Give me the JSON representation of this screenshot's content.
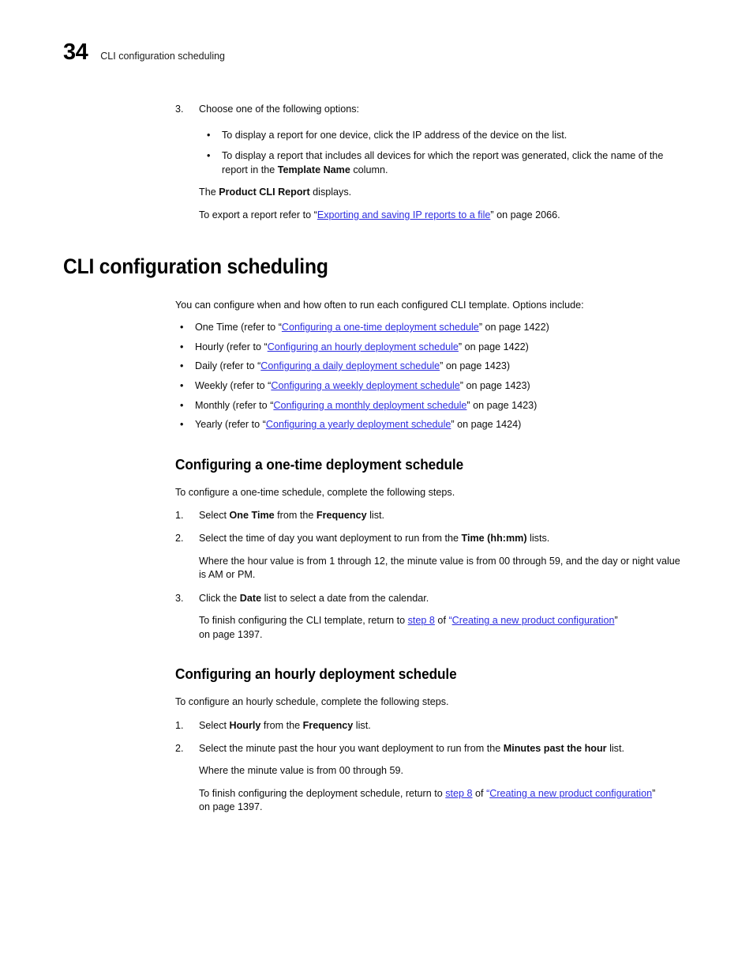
{
  "header": {
    "folio": "34",
    "running_title": "CLI configuration scheduling"
  },
  "step3": {
    "num": "3.",
    "text": "Choose one of the following options:",
    "bullets": [
      {
        "dot": "•",
        "text": "To display a report for one device, click the IP address of the device on the list."
      },
      {
        "dot": "•",
        "pre": "To display a report that includes all devices for which the report was generated, click the name of the report in the ",
        "bold": "Template Name",
        "post": " column."
      }
    ],
    "product_report": {
      "pre": "The ",
      "bold": "Product CLI Report",
      "post": " displays."
    },
    "export": {
      "pre": "To export a report refer to ",
      "openq": "“",
      "link": "Exporting and saving IP reports to a file",
      "closeq": "”",
      "post": " on page 2066."
    }
  },
  "chapter": {
    "title": "CLI configuration scheduling",
    "intro": "You can configure when and how often to run each configured CLI template. Options include:",
    "options": [
      {
        "dot": "•",
        "pre": "One Time (refer to ",
        "openq": "“",
        "link": "Configuring a one-time deployment schedule",
        "closeq": "”",
        "post": " on page 1422)"
      },
      {
        "dot": "•",
        "pre": "Hourly (refer to ",
        "openq": "“",
        "link": "Configuring an hourly deployment schedule",
        "closeq": "”",
        "post": " on page 1422)"
      },
      {
        "dot": "•",
        "pre": "Daily (refer to ",
        "openq": "“",
        "link": "Configuring a daily deployment schedule",
        "closeq": "”",
        "post": " on page 1423)"
      },
      {
        "dot": "•",
        "pre": "Weekly (refer to ",
        "openq": "“",
        "link": "Configuring a weekly deployment schedule",
        "closeq": "”",
        "post": " on page 1423)"
      },
      {
        "dot": "•",
        "pre": "Monthly (refer to ",
        "openq": "“",
        "link": "Configuring a monthly deployment schedule",
        "closeq": "”",
        "post": " on page 1423)"
      },
      {
        "dot": "•",
        "pre": "Yearly (refer to ",
        "openq": "“",
        "link": "Configuring a yearly deployment schedule",
        "closeq": "”",
        "post": " on page 1424)"
      }
    ]
  },
  "onetime": {
    "heading": "Configuring a one-time deployment schedule",
    "intro": "To configure a one-time schedule, complete the following steps.",
    "steps": [
      {
        "num": "1.",
        "pre": "Select ",
        "bold1": "One Time",
        "mid": " from the ",
        "bold2": "Frequency",
        "post": " list."
      },
      {
        "num": "2.",
        "pre": "Select the time of day you want deployment to run from the ",
        "bold1": "Time (hh:mm)",
        "post": " lists."
      },
      {
        "num": "3.",
        "pre": "Click the ",
        "bold1": "Date",
        "post": " list to select a date from the calendar."
      }
    ],
    "note_time": "Where the hour value is from 1 through 12, the minute value is from 00 through 59, and the day or night value is AM or PM.",
    "finish": {
      "pre": "To finish configuring the CLI template, return to ",
      "link_step": "step 8",
      "mid": " of ",
      "openq": "“",
      "link_title": "Creating a new product configuration",
      "closeq": "”",
      "post": " on page 1397."
    }
  },
  "hourly": {
    "heading": "Configuring an hourly deployment schedule",
    "intro": "To configure an hourly schedule, complete the following steps.",
    "steps": [
      {
        "num": "1.",
        "pre": "Select ",
        "bold1": "Hourly",
        "mid": " from the ",
        "bold2": "Frequency",
        "post": " list."
      },
      {
        "num": "2.",
        "pre": "Select the minute past the hour you want deployment to run from the ",
        "bold1": "Minutes past the hour",
        "post": " list."
      }
    ],
    "note_minute": "Where the minute value is from 00 through 59.",
    "finish": {
      "pre": "To finish configuring the deployment schedule, return to ",
      "link_step": "step 8",
      "mid": " of ",
      "openq": "“",
      "link_title": "Creating a new product configuration",
      "closeq": "”",
      "post": " on page 1397."
    }
  },
  "colors": {
    "link": "#2d2de0",
    "text": "#0d0d0d",
    "page_bg": "#ffffff"
  }
}
